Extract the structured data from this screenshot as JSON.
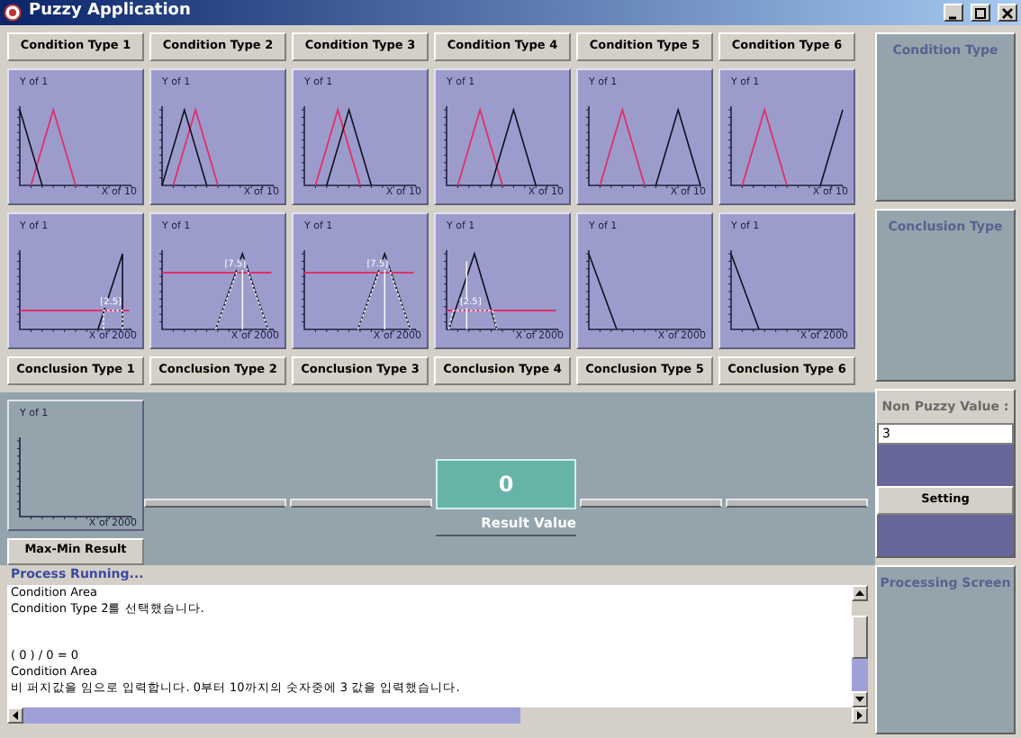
{
  "window": {
    "title": "Puzzy Application"
  },
  "condition_buttons": [
    "Condition Type 1",
    "Condition Type 2",
    "Condition Type 3",
    "Condition Type 4",
    "Condition Type 5",
    "Condition Type 6"
  ],
  "condition_charts": [
    {
      "y_label": "Y of 1",
      "x_label": "X of 10"
    },
    {
      "y_label": "Y of 1",
      "x_label": "X of 10"
    },
    {
      "y_label": "Y of 1",
      "x_label": "X of 10"
    },
    {
      "y_label": "Y of 1",
      "x_label": "X of 10"
    },
    {
      "y_label": "Y of 1",
      "x_label": "X of 10"
    },
    {
      "y_label": "Y of 1",
      "x_label": "X of 10"
    }
  ],
  "conclusion_charts": [
    {
      "y_label": "Y of 1",
      "x_label": "X of 2000",
      "marker": "[2.5]"
    },
    {
      "y_label": "Y of 1",
      "x_label": "X of 2000",
      "marker": "[7.5]"
    },
    {
      "y_label": "Y of 1",
      "x_label": "X of 2000",
      "marker": "[7.5]"
    },
    {
      "y_label": "Y of 1",
      "x_label": "X of 2000",
      "marker": "[2.5]"
    },
    {
      "y_label": "Y of 1",
      "x_label": "X of 2000"
    },
    {
      "y_label": "Y of 1",
      "x_label": "X of 2000"
    }
  ],
  "conclusion_buttons": [
    "Conclusion Type 1",
    "Conclusion Type 2",
    "Conclusion Type 3",
    "Conclusion Type 4",
    "Conclusion Type 5",
    "Conclusion Type 6"
  ],
  "max_min": {
    "chart": {
      "y_label": "Y of 1",
      "x_label": "X of 2000"
    },
    "button": "Max-Min Result"
  },
  "result": {
    "value": "0",
    "label": "Result Value"
  },
  "side": {
    "condition_title": "Condition Type",
    "conclusion_title": "Conclusion Type",
    "non_puzzy_label": "Non Puzzy Value :",
    "non_puzzy_value": "3",
    "setting_button": "Setting",
    "processing_title": "Processing Screen"
  },
  "log": {
    "title": "Process Running...",
    "lines": [
      {
        "text": "Condition Area",
        "spaced": false
      },
      {
        "text": "Condition Type 2를 선택했습니다.",
        "spaced": false
      },
      {
        "text": "( 0 ) / 0 = 0",
        "spaced": true
      },
      {
        "text": "Condition Area",
        "spaced": false
      },
      {
        "text": "비 퍼지값을 임으로 입력합니다. 0부터 10까지의 숫자중에 3 값을 입력했습니다.",
        "spaced": false
      }
    ]
  }
}
